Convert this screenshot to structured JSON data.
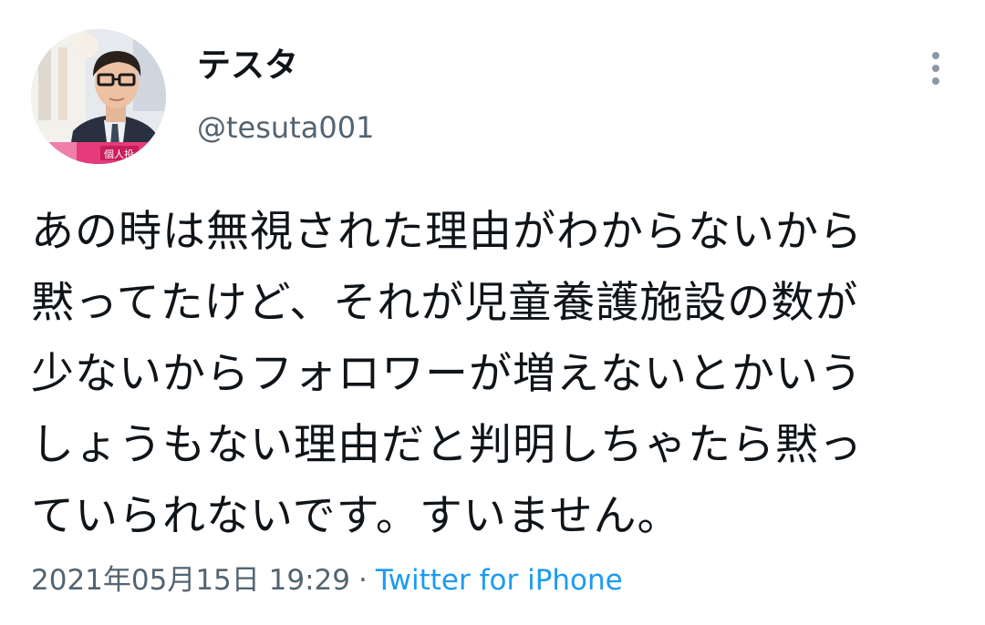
{
  "author": {
    "display_name": "テスタ",
    "handle": "@tesuta001",
    "avatar_caption": "個人投"
  },
  "more_icon": "vertical-ellipsis-icon",
  "tweet": {
    "lines": [
      "あの時は無視された理由がわからないから",
      "黙ってたけど、それが児童養護施設の数が",
      "少ないからフォロワーが増えないとかいう",
      "しょうもない理由だと判明しちゃたら黙っ",
      "ていられないです。すいません。"
    ]
  },
  "meta": {
    "timestamp": "2021年05月15日 19:29",
    "separator": "·",
    "source": "Twitter for iPhone"
  },
  "colors": {
    "text": "#0f1419",
    "secondary": "#536471",
    "link": "#1d9bf0"
  }
}
